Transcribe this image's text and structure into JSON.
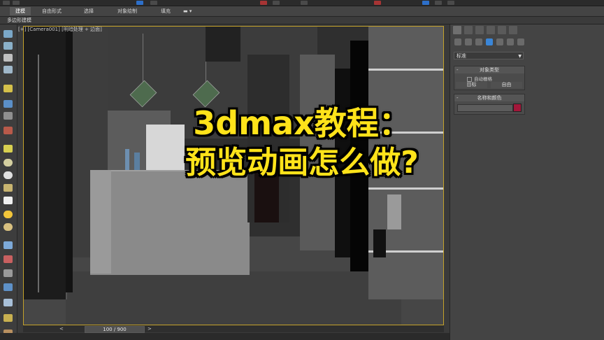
{
  "ribbon": {
    "tabs": [
      "建模",
      "自由形式",
      "选择",
      "对象绘制",
      "填充"
    ],
    "active_tab": "建模",
    "subtab": "多边形建模"
  },
  "viewport": {
    "label": "[+] [Camera001] [明暗处理 + 边面]",
    "frame_color": "#c4a22a"
  },
  "overlay": {
    "line1": "3dmax教程：",
    "line2": "预览动画怎么做?",
    "text_color": "#ffe31a"
  },
  "timeline": {
    "frame_readout": "100 / 900",
    "prev": "<",
    "next": ">"
  },
  "command_panel": {
    "category": "标准",
    "object_type": {
      "title": "对象类型",
      "autogrid": "自动栅格",
      "buttons": [
        "目标",
        "自由"
      ]
    },
    "name_color": {
      "title": "名称和颜色",
      "swatch_color": "#a3173a"
    },
    "collapse_symbol": "-"
  }
}
